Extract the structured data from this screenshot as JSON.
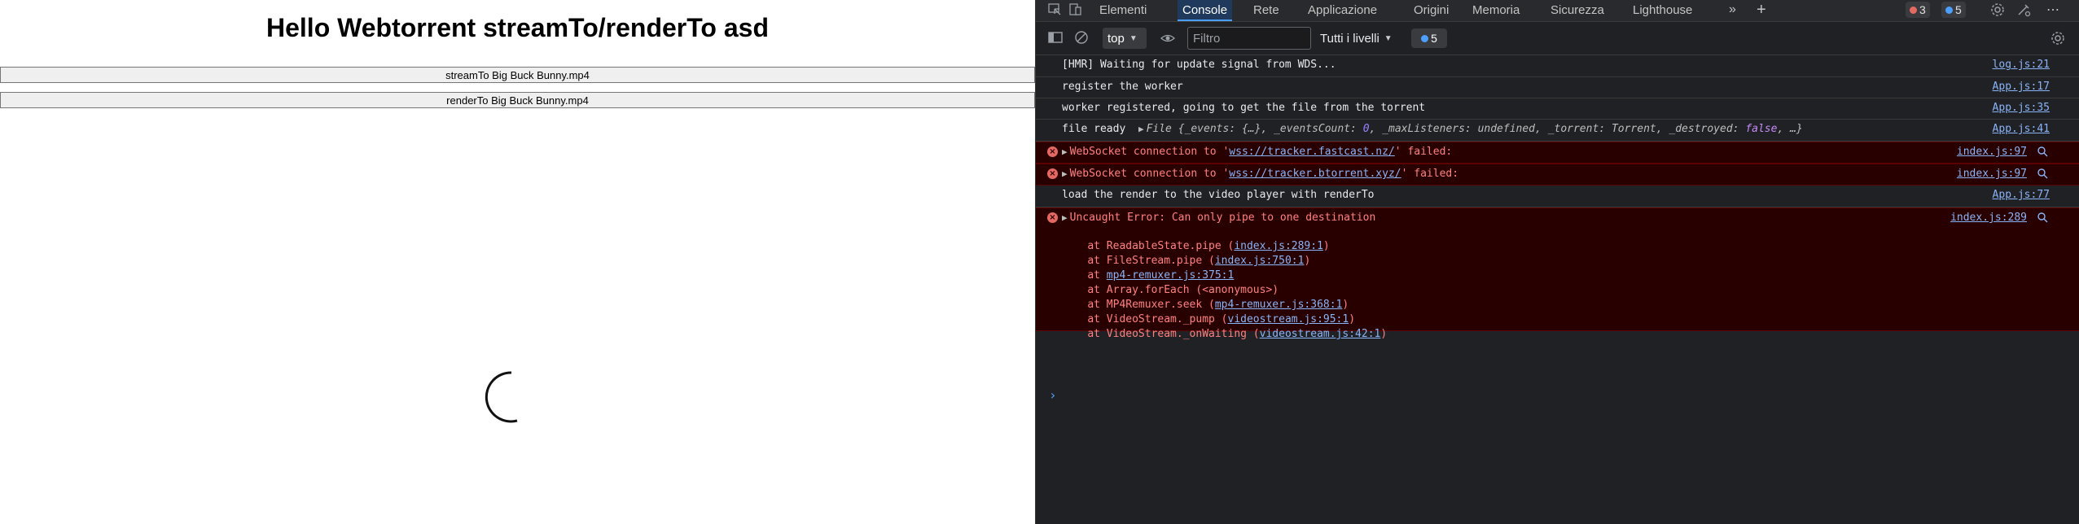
{
  "page": {
    "title": "Hello Webtorrent streamTo/renderTo asd",
    "stream_button": "streamTo Big Buck Bunny.mp4",
    "render_button": "renderTo Big Buck Bunny.mp4"
  },
  "devtools": {
    "tabs": [
      "Elementi",
      "Console",
      "Rete",
      "Applicazione",
      "Origini",
      "Memoria",
      "Sicurezza",
      "Lighthouse"
    ],
    "active_tab": "Console",
    "error_count": "3",
    "message_count": "5",
    "toolbar": {
      "context": "top",
      "filter_placeholder": "Filtro",
      "levels": "Tutti i livelli",
      "issues_count": "5"
    },
    "colors": {
      "accent": "#4d9fff",
      "error_bg": "#290000",
      "error_text": "#ff8080",
      "link": "#8ab4f8"
    },
    "console": [
      {
        "type": "log",
        "text": "[HMR] Waiting for update signal from WDS...",
        "source": "log.js:21"
      },
      {
        "type": "log",
        "text": "register the worker",
        "source": "App.js:17"
      },
      {
        "type": "log",
        "text": "worker registered, going to get the file from the torrent",
        "source": "App.js:35"
      },
      {
        "type": "log",
        "text": "file ready",
        "source": "App.js:41",
        "object": {
          "prefix": "File {",
          "events": "_events: {…}",
          "eventsCount_key": "_eventsCount:",
          "eventsCount_val": "0",
          "maxListeners": "_maxListeners: undefined",
          "torrent": "_torrent: Torrent",
          "destroyed_key": "_destroyed:",
          "destroyed_val": "false",
          "suffix": ", …}"
        }
      },
      {
        "type": "error",
        "pre": "WebSocket connection to '",
        "url": "wss://tracker.fastcast.nz/",
        "post": "' failed:",
        "source": "index.js:97"
      },
      {
        "type": "error",
        "pre": "WebSocket connection to '",
        "url": "wss://tracker.btorrent.xyz/",
        "post": "' failed:",
        "source": "index.js:97"
      },
      {
        "type": "log",
        "text": "load the render to the video player with renderTo",
        "source": "App.js:77"
      },
      {
        "type": "error",
        "text": "Uncaught Error: Can only pipe to one destination",
        "source": "index.js:289",
        "stack": [
          {
            "pre": "at ReadableState.pipe (",
            "link": "index.js:289:1",
            "post": ")"
          },
          {
            "pre": "at FileStream.pipe (",
            "link": "index.js:750:1",
            "post": ")"
          },
          {
            "pre": "at ",
            "link": "mp4-remuxer.js:375:1",
            "post": ""
          },
          {
            "pre": "at Array.forEach (<anonymous>)",
            "link": "",
            "post": ""
          },
          {
            "pre": "at MP4Remuxer.seek (",
            "link": "mp4-remuxer.js:368:1",
            "post": ")"
          },
          {
            "pre": "at VideoStream._pump (",
            "link": "videostream.js:95:1",
            "post": ")"
          },
          {
            "pre": "at VideoStream._onWaiting (",
            "link": "videostream.js:42:1",
            "post": ")"
          }
        ]
      }
    ]
  }
}
